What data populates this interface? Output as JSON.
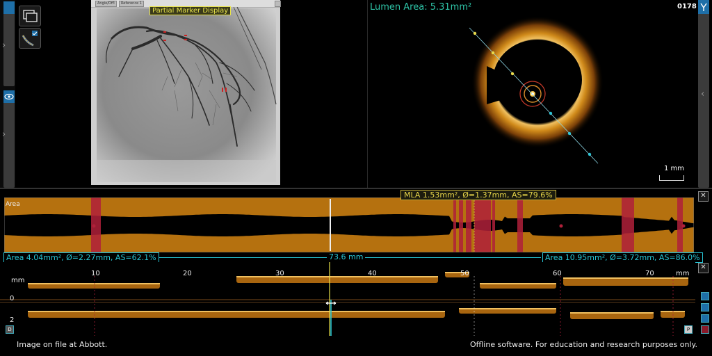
{
  "angio": {
    "overlay_label": "Partial Marker Display",
    "toolbar_tabs": [
      "Angio/Offl",
      "Reference 1"
    ]
  },
  "oct": {
    "lumen_area": "Lumen Area: 5.31mm²",
    "frame_number": "0178",
    "scale_label": "1 mm"
  },
  "lumen_profile": {
    "area_label": "Area",
    "mla": "MLA 1.53mm², Ø=1.37mm, AS=79.6%",
    "left_reference": "Area 4.04mm², Ø=2.27mm, AS=62.1%",
    "right_reference": "Area 10.95mm², Ø=3.72mm, AS=86.0%",
    "length": "73.6 mm"
  },
  "long_view": {
    "unit_left": "mm",
    "unit_right": "mm",
    "ticks": [
      "10",
      "20",
      "30",
      "40",
      "50",
      "60",
      "70"
    ],
    "depth_labels": [
      "0",
      "2"
    ],
    "end_left": "D",
    "end_right": "P"
  },
  "footer": {
    "left": "Image on file at Abbott.",
    "right": "Offline software. For education and research purposes only."
  },
  "colors": {
    "accent_cyan": "#27c6d6",
    "mla_yellow": "#e6d54a",
    "lumen_green": "#2ec5a8",
    "tissue_orange": "#b5710f",
    "stenosis_red": "#b0203a"
  },
  "icons": [
    "chevron-right-icon",
    "eye-icon",
    "window-icon",
    "catheter-icon",
    "chevron-left-icon",
    "close-icon"
  ]
}
